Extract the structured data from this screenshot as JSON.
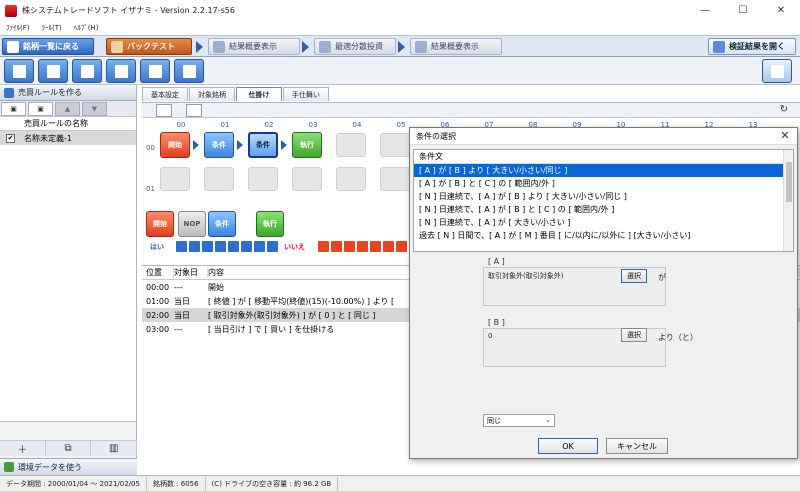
{
  "window": {
    "title": "株システムトレードソフト イザナミ - Version 2.2.17-s56"
  },
  "menu": [
    "ﾌｧｲﾙ(F)",
    "ﾂｰﾙ(T)",
    "ﾍﾙﾌﾟ(H)"
  ],
  "nav_tabs": {
    "back": "銘柄一覧に戻る",
    "backtest": "バックテスト",
    "summary1": "結果概要表示",
    "optimize": "最適分散投資",
    "summary2": "結果概要表示",
    "verify": "検証結果を開く"
  },
  "left_panel": {
    "header": "売買ルールを作る",
    "column": "売買ルールの名称",
    "rules": [
      {
        "checked": "✔",
        "name": "名称未定義-1"
      }
    ],
    "footer": "環境データを使う"
  },
  "sub_tabs": [
    "基本設定",
    "対象銘柄",
    "仕掛け",
    "手仕舞い"
  ],
  "grid": {
    "columns": [
      "00",
      "01",
      "02",
      "03",
      "04",
      "05",
      "06",
      "07",
      "08",
      "09",
      "10",
      "11",
      "12",
      "13"
    ],
    "rows": [
      "00",
      "01"
    ],
    "nodes": {
      "start": "開始",
      "cond1": "条件",
      "cond2": "条件",
      "exec": "執行"
    }
  },
  "palette": {
    "start": "開始",
    "nop": "NOP",
    "cond": "条件",
    "exec": "執行",
    "yes": "はい",
    "no": "いいえ"
  },
  "rule_list": {
    "headers": {
      "pos": "位置",
      "date": "対象日",
      "content": "内容"
    },
    "rows": [
      {
        "pos": "00:00",
        "date": "---",
        "content": "開始"
      },
      {
        "pos": "01:00",
        "date": "当日",
        "content": "[ 終値 ] が [ 移動平均(終値)(15)(-10.00%) ] より ["
      },
      {
        "pos": "02:00",
        "date": "当日",
        "content": "[ 取引対象外(取引対象外) ] が [ 0 ] と [ 同じ ]"
      },
      {
        "pos": "03:00",
        "date": "---",
        "content": "[ 当日引け ] で [ 買い ] を仕掛ける"
      }
    ]
  },
  "dialog": {
    "title": "条件の選択",
    "list_header": "条件文",
    "items": [
      "[ A ] が [ B ] より [ 大きい/小さい/同じ ]",
      "[ A ] が [ B ] と [ C ] の [ 範囲内/外 ]",
      "[ N ] 日連続で、[ A ] が [ B ] より [ 大きい/小さい/同じ ]",
      "[ N ] 日連続で、[ A ] が [ B ] と [ C ] の [ 範囲内/外 ]",
      "[ N ] 日連続で、[ A ] が [ 大きい/小さい ]",
      "過去 [ N ] 日間で、[ A ] が [ M ] 番目 [ に/以内に/以外に ] [大きい/小さい]"
    ],
    "param_a": {
      "tag": "[ A ]",
      "value": "取引対象外(取引対象外)",
      "button": "選択",
      "suffix": "が"
    },
    "param_b": {
      "tag": "[ B ]",
      "value": "0",
      "button": "選択",
      "suffix": "より（と）"
    },
    "compare": "同じ",
    "ok": "OK",
    "cancel": "キャンセル"
  },
  "status": {
    "period": "データ期間 : 2000/01/04 〜 2021/02/05",
    "count": "銘柄数 : 6056",
    "disk": "(C) ドライブの空き容量 : 約 96.2 GB"
  }
}
